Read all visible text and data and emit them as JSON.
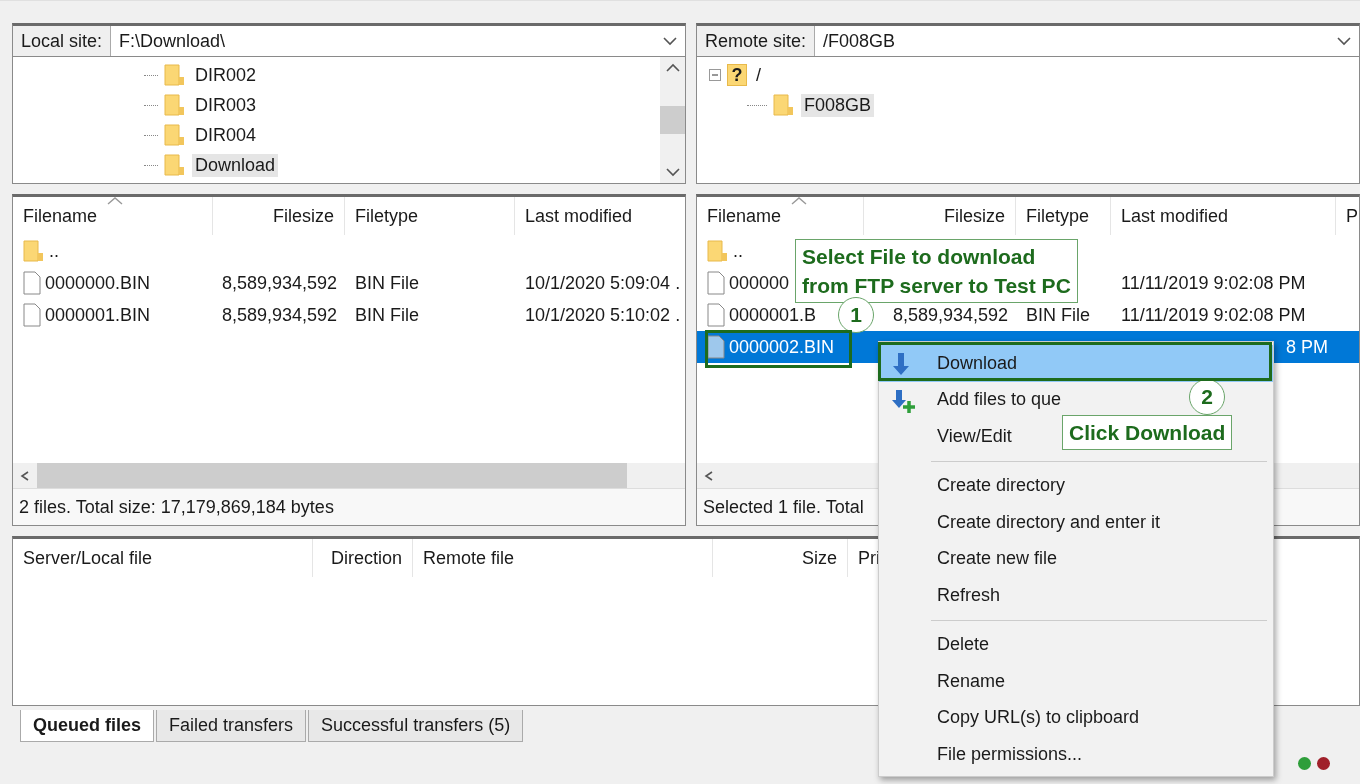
{
  "local_site": {
    "label": "Local site:",
    "path": "F:\\Download\\"
  },
  "local_tree": [
    {
      "label": "DIR002",
      "selected": false
    },
    {
      "label": "DIR003",
      "selected": false
    },
    {
      "label": "DIR004",
      "selected": false
    },
    {
      "label": "Download",
      "selected": true
    }
  ],
  "remote_site": {
    "label": "Remote site:",
    "path": "/F008GB"
  },
  "remote_tree": {
    "badge": "?",
    "label": "/",
    "expanded": true,
    "children": [
      {
        "label": "F008GB",
        "selected": true
      }
    ]
  },
  "local_files": {
    "columns": [
      "Filename",
      "Filesize",
      "Filetype",
      "Last modified"
    ],
    "rows": [
      {
        "kind": "folder",
        "name": "..",
        "selected": false
      },
      {
        "kind": "file",
        "name": "0000000.BIN",
        "size": "8,589,934,592",
        "type": "BIN File",
        "modified": "10/1/2020 5:09:04 .",
        "selected": false
      },
      {
        "kind": "file",
        "name": "0000001.BIN",
        "size": "8,589,934,592",
        "type": "BIN File",
        "modified": "10/1/2020 5:10:02 .",
        "selected": false
      }
    ],
    "status": "2 files. Total size: 17,179,869,184 bytes"
  },
  "remote_files": {
    "columns": [
      "Filename",
      "Filesize",
      "Filetype",
      "Last modified",
      "P"
    ],
    "rows": [
      {
        "kind": "folder",
        "name": "..",
        "selected": false
      },
      {
        "kind": "file",
        "name": "000000",
        "modified": "11/11/2019 9:02:08 PM",
        "selected": false
      },
      {
        "kind": "file",
        "name": "0000001.B",
        "size": "8,589,934,592",
        "type": "BIN File",
        "modified": "11/11/2019 9:02:08 PM",
        "selected": false
      },
      {
        "kind": "file",
        "name": "0000002.BIN",
        "modified": "8 PM",
        "selected": true
      }
    ],
    "status": "Selected 1 file. Total"
  },
  "queue": {
    "columns": [
      "Server/Local file",
      "Direction",
      "Remote file",
      "Size",
      "Pri"
    ]
  },
  "queue_tabs": [
    {
      "label": "Queued files",
      "selected": true
    },
    {
      "label": "Failed transfers",
      "selected": false
    },
    {
      "label": "Successful transfers (5)",
      "selected": false
    }
  ],
  "context_menu": [
    {
      "kind": "download",
      "label": "Download",
      "highlighted": true
    },
    {
      "kind": "enqueue",
      "label": "Add files to que",
      "highlighted": false
    },
    {
      "kind": "item",
      "label": "View/Edit",
      "highlighted": false
    },
    {
      "kind": "separator"
    },
    {
      "kind": "item",
      "label": "Create directory",
      "highlighted": false
    },
    {
      "kind": "item",
      "label": "Create directory and enter it",
      "highlighted": false
    },
    {
      "kind": "item",
      "label": "Create new file",
      "highlighted": false
    },
    {
      "kind": "item",
      "label": "Refresh",
      "highlighted": false
    },
    {
      "kind": "separator"
    },
    {
      "kind": "item",
      "label": "Delete",
      "highlighted": false
    },
    {
      "kind": "item",
      "label": "Rename",
      "highlighted": false
    },
    {
      "kind": "item",
      "label": "Copy URL(s) to clipboard",
      "highlighted": false
    },
    {
      "kind": "item",
      "label": "File permissions...",
      "highlighted": false
    }
  ],
  "annotations": [
    {
      "kind": "callout",
      "text": "Select File to download\nfrom FTP server to Test PC"
    },
    {
      "kind": "marker",
      "text": "1"
    },
    {
      "kind": "marker",
      "text": "2"
    },
    {
      "kind": "callout",
      "text": "Click Download"
    }
  ]
}
